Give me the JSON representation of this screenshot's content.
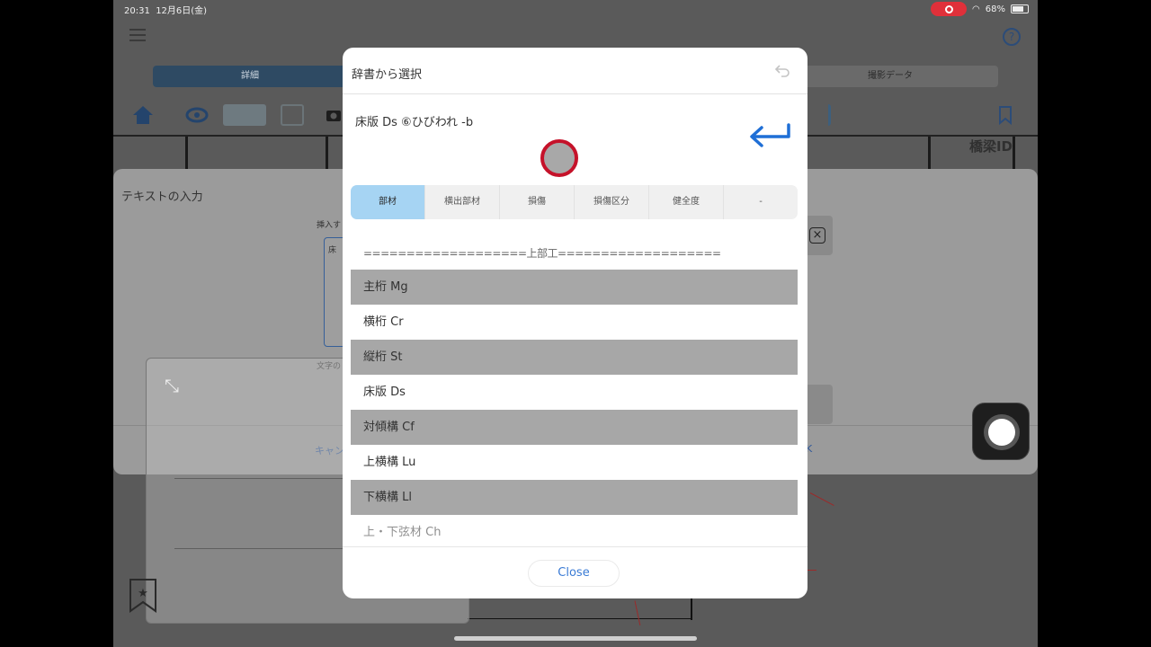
{
  "status_bar": {
    "time": "20:31",
    "date": "12月6日(金)",
    "battery": "68%",
    "battery_level": 0.68
  },
  "background": {
    "tab_left": "詳細",
    "tab_right": "撮影データ",
    "column_header": "橋梁ID",
    "text_panel_title": "テキストの入力",
    "insert_label": "挿入す",
    "field_prefix": "床",
    "font_label": "文字の",
    "cancel_label": "キャン",
    "ok_label": "K"
  },
  "dialog": {
    "title": "辞書から選択",
    "current_text": "床版 Ds ⑥ひびわれ -b",
    "tabs": [
      "部材",
      "横出部材",
      "損傷",
      "損傷区分",
      "健全度",
      "-"
    ],
    "section_header": "===================上部工===================",
    "items": [
      {
        "label": "主桁 Mg",
        "shaded": true
      },
      {
        "label": "横桁 Cr",
        "shaded": false
      },
      {
        "label": "縦桁 St",
        "shaded": true
      },
      {
        "label": "床版 Ds",
        "shaded": false
      },
      {
        "label": "対傾構 Cf",
        "shaded": true
      },
      {
        "label": "上横構 Lu",
        "shaded": false
      },
      {
        "label": "下横構 Ll",
        "shaded": true
      },
      {
        "label": "上・下弦材 Ch",
        "shaded": false
      }
    ],
    "close_label": "Close"
  },
  "colors": {
    "accent": "#3a7bd5",
    "tab_active": "#a6d4f3",
    "record": "#c5122a"
  }
}
